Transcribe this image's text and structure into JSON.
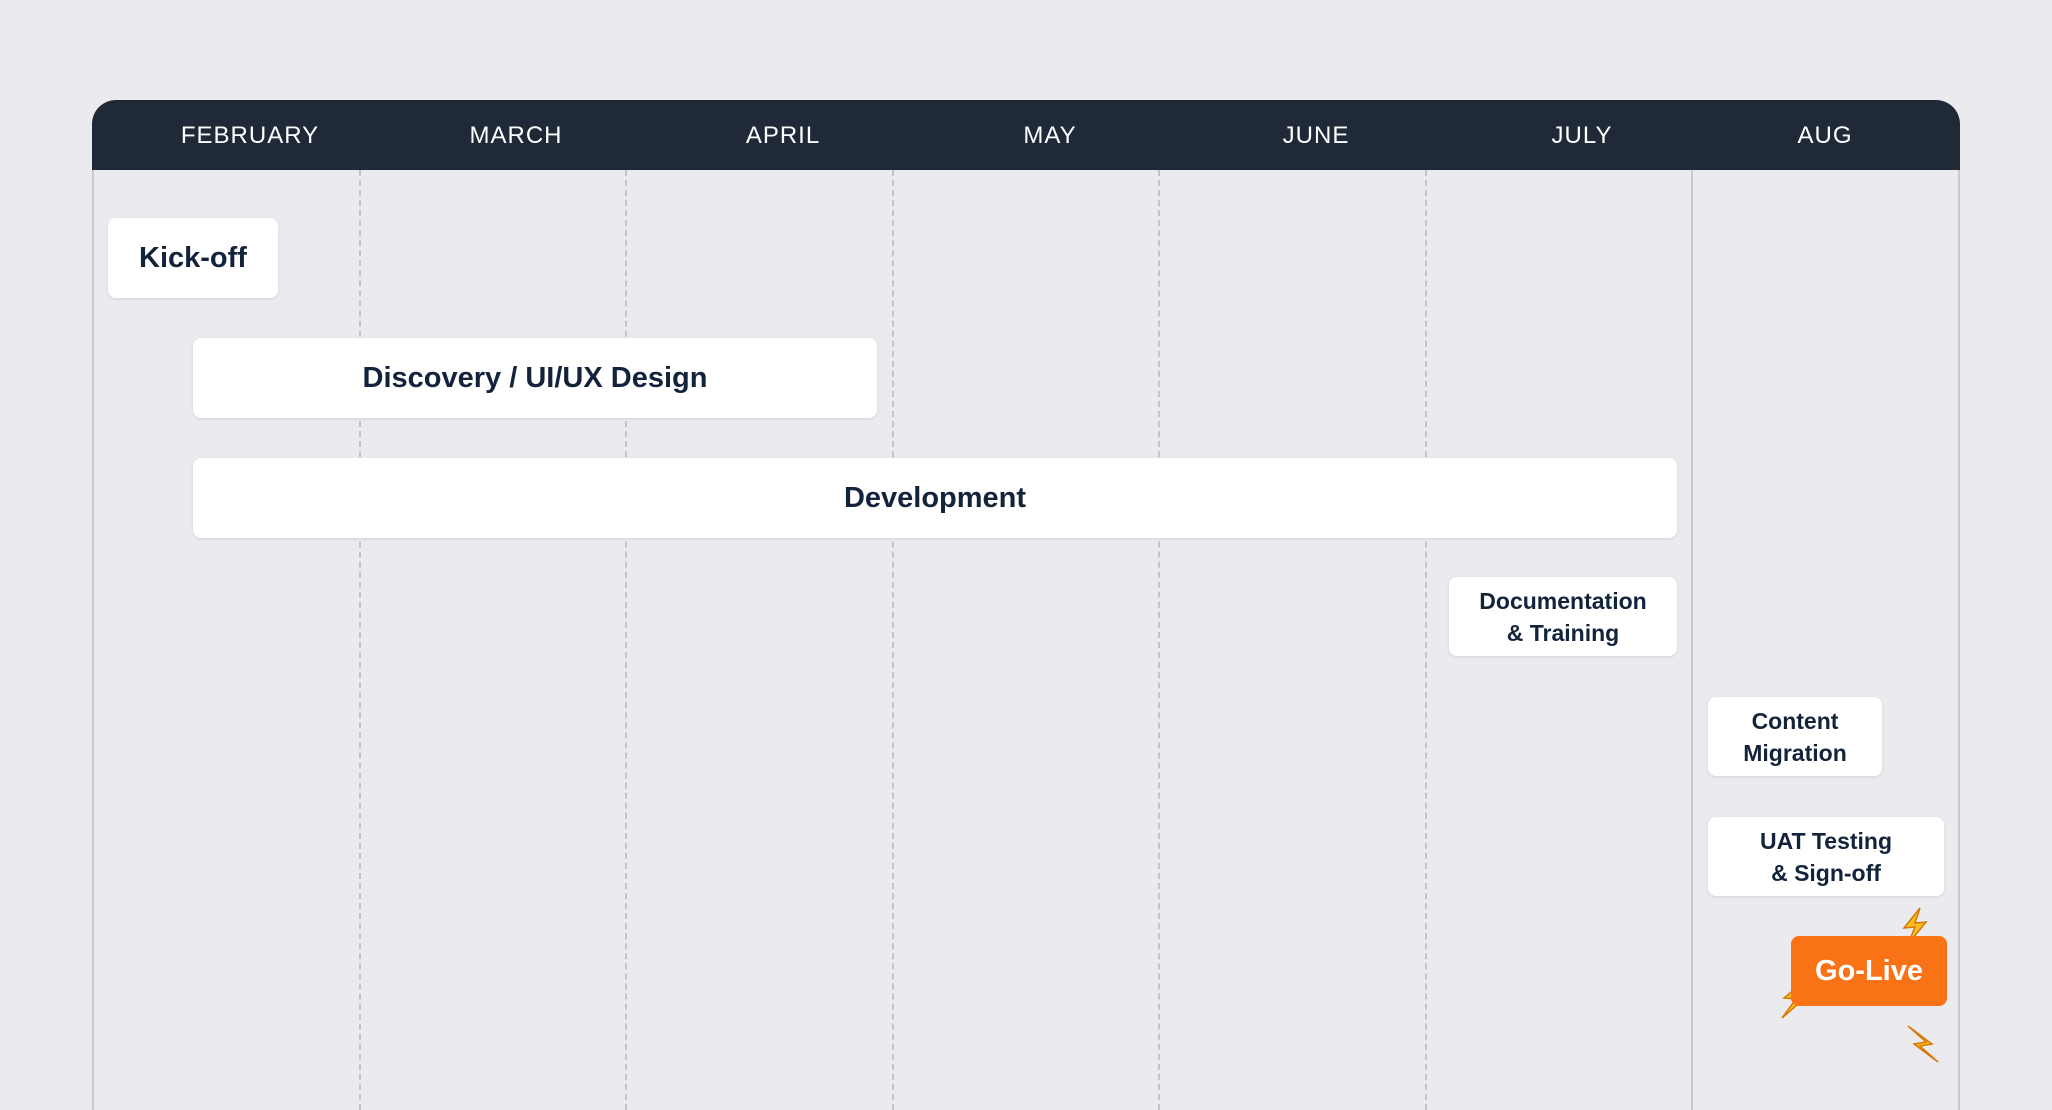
{
  "months": [
    "FEBRUARY",
    "MARCH",
    "APRIL",
    "MAY",
    "JUNE",
    "JULY",
    "AUG"
  ],
  "tasks": {
    "kickoff": "Kick-off",
    "discovery": "Discovery / UI/UX Design",
    "development": "Development",
    "documentation_line1": "Documentation",
    "documentation_line2": "& Training",
    "content_line1": "Content",
    "content_line2": "Migration",
    "uat_line1": "UAT Testing",
    "uat_line2": "& Sign-off",
    "golive": "Go-Live"
  },
  "colors": {
    "header": "#1f2937",
    "background": "#ebebef",
    "task_text": "#13233b",
    "golive": "#f97316",
    "bolt": "#fbbf24"
  },
  "icons": [
    "lightning-bolt-icon"
  ]
}
